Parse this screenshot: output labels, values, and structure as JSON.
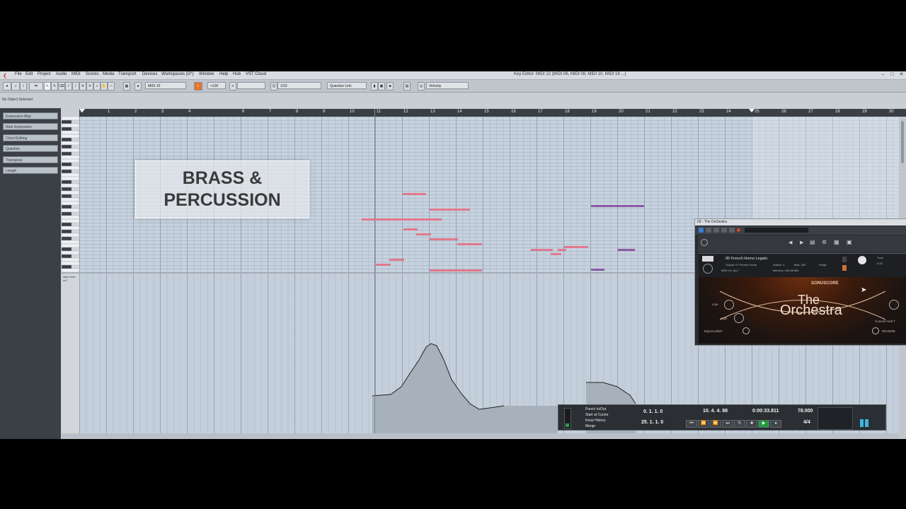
{
  "menubar": {
    "items": [
      "File",
      "Edit",
      "Project",
      "Audio",
      "MIDI",
      "Scores",
      "Media",
      "Transport",
      "Devices",
      "Workspaces (G*)",
      "Window",
      "Help",
      "Hub",
      "VST Cloud"
    ],
    "window_title": "Key Editor: MIDI 22 (MIDI 06, MIDI 08, MIDI 10, MIDI 19 ...)"
  },
  "toolbar": {
    "track_field": "MIDI 22",
    "value_field": "+100",
    "quantize_value": "1/32",
    "quantize_link": "Quantize Link",
    "controller": "Velocity"
  },
  "status": {
    "selection": "No Object Selected"
  },
  "inspector": {
    "sections": [
      "Expression Map",
      "Note Expression",
      "Chord Editing",
      "Quantize",
      "Transpose",
      "Length"
    ]
  },
  "ruler": {
    "bars": [
      "0",
      "1",
      "2",
      "3",
      "4",
      "6",
      "7",
      "8",
      "9",
      "10",
      "11",
      "12",
      "13",
      "14",
      "15",
      "16",
      "17",
      "18",
      "19",
      "20",
      "21",
      "22",
      "23",
      "24",
      "25",
      "26",
      "27",
      "28",
      "29",
      "30"
    ]
  },
  "lane": {
    "label": "Main Velo cc7"
  },
  "overlay": {
    "line1": "BRASS &",
    "line2": "PERCUSSION"
  },
  "kontakt": {
    "window_title": "03 - The Orchestra",
    "instrument_name": "05 French Horns Legato",
    "output": "Output: 07 French Horns",
    "voices": "Voices: 3",
    "max": "Max: 200",
    "midi_ch": "MIDI Ch: [A] 7",
    "memory": "Memory: 156.68 MB",
    "purge": "Purge",
    "tune_label": "Tune",
    "tune_value": "0.00",
    "brand": "SONUSCORE",
    "product_line1": "The",
    "product_line2": "Orchestra",
    "eq_label": "EQUALIZER",
    "eq_low": "Low",
    "eq_high": "High",
    "reverb_label": "REVERB",
    "reverb_preset": "Concert Hall T"
  },
  "transport": {
    "punch": [
      "Punch In/Out",
      "Start at Cursor",
      "Keep History",
      "Merge"
    ],
    "left_locator": "0. 1. 1. 0",
    "right_locator": "25. 1. 1. 0",
    "position_bars": "10. 4. 4. 98",
    "position_time": "0:00:33.811",
    "tempo": "78.000",
    "signature": "4/4"
  },
  "colors": {
    "note_pink": "#e0798c",
    "note_red": "#c41a3a",
    "note_purple": "#8a5aa6",
    "accent_orange": "#e8732a"
  }
}
